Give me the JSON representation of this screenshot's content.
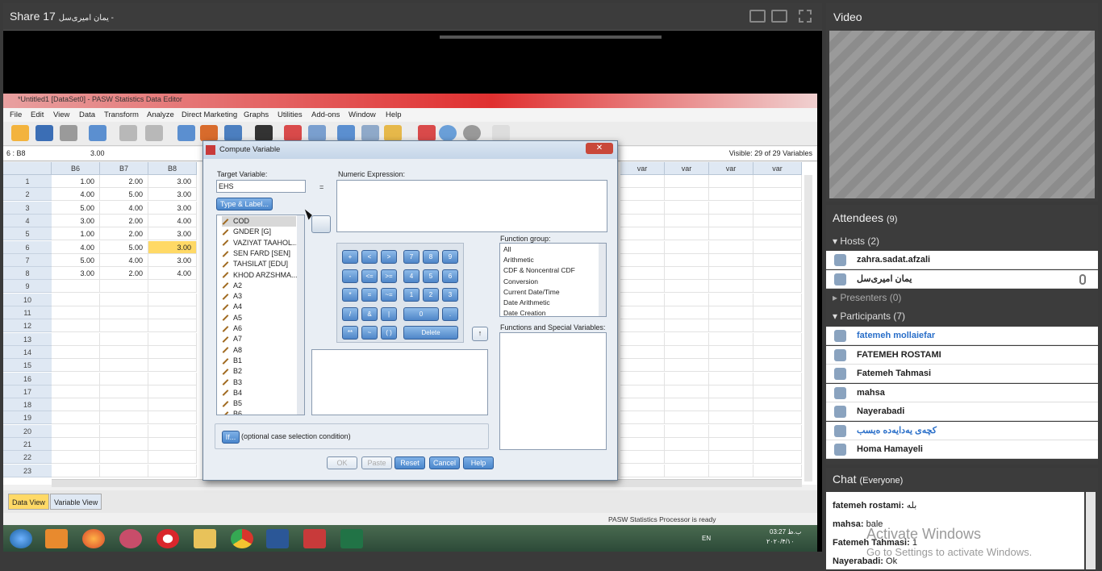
{
  "share": {
    "title": "Share 17",
    "presenter": "یمان امیری‌سل -"
  },
  "spss": {
    "window_title": "*Untitled1 [DataSet0] - PASW Statistics Data Editor",
    "menu": [
      "File",
      "Edit",
      "View",
      "Data",
      "Transform",
      "Analyze",
      "Direct Marketing",
      "Graphs",
      "Utilities",
      "Add-ons",
      "Window",
      "Help"
    ],
    "cell_ref": "6 : B8",
    "cell_value": "3.00",
    "visible": "Visible: 29 of 29 Variables",
    "columns": [
      "B6",
      "B7",
      "B8"
    ],
    "var_cols": [
      "var",
      "var",
      "var",
      "var"
    ],
    "rows": [
      [
        "1.00",
        "2.00",
        "3.00"
      ],
      [
        "4.00",
        "5.00",
        "3.00"
      ],
      [
        "5.00",
        "4.00",
        "3.00"
      ],
      [
        "3.00",
        "2.00",
        "4.00"
      ],
      [
        "1.00",
        "2.00",
        "3.00"
      ],
      [
        "4.00",
        "5.00",
        "3.00"
      ],
      [
        "5.00",
        "4.00",
        "3.00"
      ],
      [
        "3.00",
        "2.00",
        "4.00"
      ]
    ],
    "row_numbers": [
      "1",
      "2",
      "3",
      "4",
      "5",
      "6",
      "7",
      "8",
      "9",
      "10",
      "11",
      "12",
      "13",
      "14",
      "15",
      "16",
      "17",
      "18",
      "19",
      "20",
      "21",
      "22",
      "23"
    ],
    "tabs": {
      "data": "Data View",
      "variable": "Variable View"
    },
    "status": "PASW Statistics Processor is ready",
    "clock_time": "03:27 ب.ظ",
    "clock_date": "۲۰۲۰/۴/۱۰",
    "lang": "EN"
  },
  "dialog": {
    "title": "Compute Variable",
    "target_label": "Target Variable:",
    "target_value": "EHS",
    "equals": "=",
    "numeric_label": "Numeric Expression:",
    "type_label_btn": "Type & Label...",
    "variables": [
      "COD",
      "GNDER [G]",
      "VAZIYAT TAAHOL...",
      "SEN FARD [SEN]",
      "TAHSILAT [EDU]",
      "KHOD ARZSHMA...",
      "A2",
      "A3",
      "A4",
      "A5",
      "A6",
      "A7",
      "A8",
      "B1",
      "B2",
      "B3",
      "B4",
      "B5",
      "B6"
    ],
    "keypad": [
      [
        "+",
        "<",
        ">",
        "7",
        "8",
        "9"
      ],
      [
        "-",
        "<=",
        ">=",
        "4",
        "5",
        "6"
      ],
      [
        "*",
        "=",
        "~=",
        "1",
        "2",
        "3"
      ],
      [
        "/",
        "&",
        "|",
        "0",
        "."
      ],
      [
        "**",
        "~",
        "( )",
        "Delete"
      ]
    ],
    "function_group_label": "Function group:",
    "function_groups": [
      "All",
      "Arithmetic",
      "CDF & Noncentral CDF",
      "Conversion",
      "Current Date/Time",
      "Date Arithmetic",
      "Date Creation"
    ],
    "functions_label": "Functions and Special Variables:",
    "if_btn": "If...",
    "if_text": "(optional case selection condition)",
    "buttons": {
      "ok": "OK",
      "paste": "Paste",
      "reset": "Reset",
      "cancel": "Cancel",
      "help": "Help"
    }
  },
  "video": {
    "title": "Video"
  },
  "attendees": {
    "title": "Attendees",
    "count": "(9)",
    "hosts_label": "Hosts (2)",
    "hosts": [
      "zahra.sadat.afzali",
      "یمان امیری‌سل"
    ],
    "presenters_label": "Presenters (0)",
    "participants_label": "Participants (7)",
    "participants": [
      "fatemeh mollaiefar",
      "FATEMEH ROSTAMI",
      "Fatemeh Tahmasi",
      "mahsa",
      "Nayerabadi",
      "کچەی یەدایەدە ەیسب",
      "Homa Hamayeli"
    ]
  },
  "chat": {
    "title": "Chat",
    "scope": "(Everyone)",
    "messages": [
      {
        "name": "fatemeh rostami:",
        "text": "بله"
      },
      {
        "name": "mahsa:",
        "text": "bale"
      },
      {
        "name": "Fatemeh Tahmasi:",
        "text": "1"
      },
      {
        "name": "Nayerabadi:",
        "text": "Ok"
      }
    ]
  },
  "watermark": {
    "line1": "Activate Windows",
    "line2": "Go to Settings to activate Windows."
  },
  "colors": {
    "accent": "#4a86cc",
    "pod_bg": "#3c3c3c",
    "highlight": "#ffd966"
  }
}
